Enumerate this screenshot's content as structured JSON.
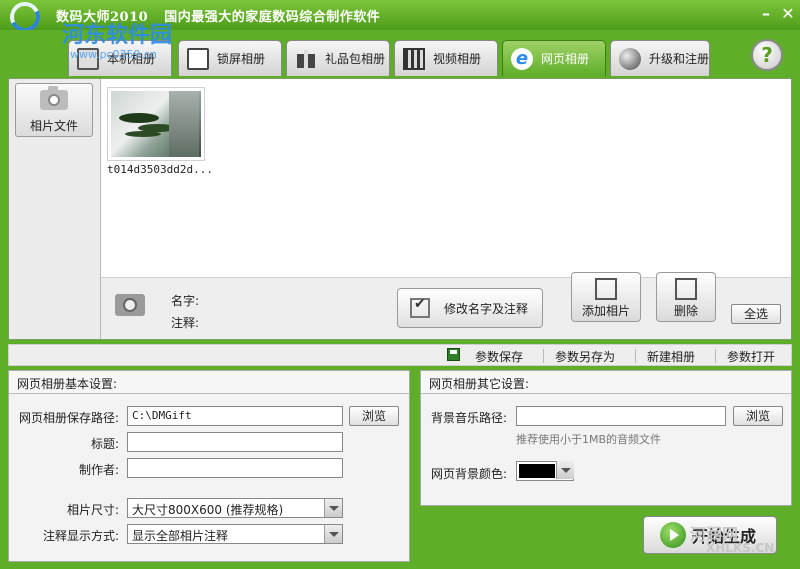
{
  "titlebar": {
    "app_name": "数码大师2010",
    "subtitle": "国内最强大的家庭数码综合制作软件",
    "minimize": "–",
    "close": "✕"
  },
  "watermark": {
    "site": "河东软件园",
    "url": "www.pc0359.cn"
  },
  "tabs": [
    {
      "label": "本机相册",
      "icon": "photo-icon",
      "active": false
    },
    {
      "label": "锁屏相册",
      "icon": "monitor-icon",
      "active": false
    },
    {
      "label": "礼品包相册",
      "icon": "gift-icon",
      "active": false
    },
    {
      "label": "视频相册",
      "icon": "film-icon",
      "active": false
    },
    {
      "label": "网页相册",
      "icon": "ie-icon",
      "active": true
    },
    {
      "label": "升级和注册",
      "icon": "globe-icon",
      "active": false
    }
  ],
  "help": "?",
  "sidebar": {
    "photo_files": "相片文件"
  },
  "thumbnails": [
    {
      "caption": "t014d3503dd2d..."
    }
  ],
  "info": {
    "name_label": "名字:",
    "note_label": "注释:",
    "edit_button": "修改名字及注释",
    "add_photo": "添加相片",
    "delete": "删除",
    "select_all": "全选"
  },
  "toolbar": {
    "save": "参数保存",
    "save_as": "参数另存为",
    "new_album": "新建相册",
    "open": "参数打开"
  },
  "basic": {
    "heading": "网页相册基本设置:",
    "path_label": "网页相册保存路径:",
    "path_value": "C:\\DMGift",
    "browse": "浏览",
    "title_label": "标题:",
    "title_value": "",
    "author_label": "制作者:",
    "author_value": "",
    "size_label": "相片尺寸:",
    "size_value": "大尺寸800X600 (推荐规格)",
    "caption_label": "注释显示方式:",
    "caption_value": "显示全部相片注释"
  },
  "other": {
    "heading": "网页相册其它设置:",
    "music_label": "背景音乐路径:",
    "music_value": "",
    "browse": "浏览",
    "hint": "推荐使用小于1MB的音频文件",
    "bgcolor_label": "网页背景颜色:",
    "bgcolor": "#000000"
  },
  "start_button": "开始生成",
  "corner_watermark": {
    "cn": "河润网",
    "en": "XHLKS.CN"
  },
  "colors": {
    "accent": "#5fae2a",
    "active_tab": "#4e9c1c"
  }
}
